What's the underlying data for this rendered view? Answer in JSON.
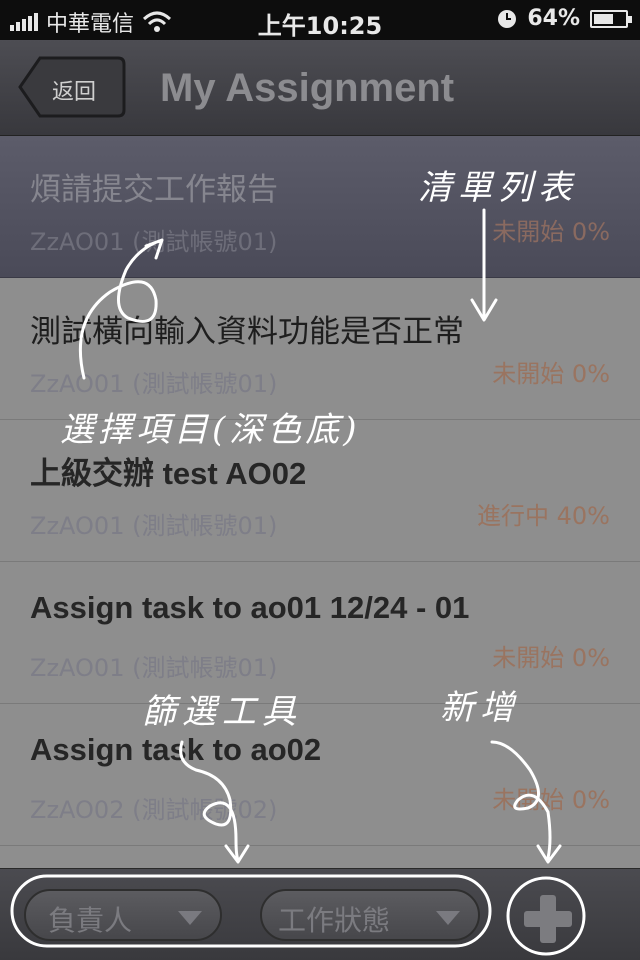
{
  "status_bar": {
    "carrier": "中華電信",
    "time": "上午10:25",
    "battery": "64%",
    "battery_level": 0.64
  },
  "nav": {
    "back_label": "返回",
    "title": "My Assignment"
  },
  "list": [
    {
      "title": "煩請提交工作報告",
      "owner": "ZzAO01 (測試帳號01)",
      "status": "未開始 0%",
      "selected": true
    },
    {
      "title": "測試橫向輸入資料功能是否正常",
      "owner": "ZzAO01 (測試帳號01)",
      "status": "未開始 0%",
      "selected": false
    },
    {
      "title": "上級交辦 test AO02",
      "owner": "ZzAO01 (測試帳號01)",
      "status": "進行中 40%",
      "selected": false
    },
    {
      "title": "Assign task to ao01 12/24 - 01",
      "owner": "ZzAO01 (測試帳號01)",
      "status": "未開始 0%",
      "selected": false
    },
    {
      "title": "Assign task to ao02",
      "owner": "ZzAO02 (測試帳號02)",
      "status": "未開始 0%",
      "selected": false
    }
  ],
  "toolbar": {
    "filter_owner": "負責人",
    "filter_status": "工作狀態"
  },
  "annotations": {
    "list_label": "清單列表",
    "selected_label": "選擇項目(深色底)",
    "filter_label": "篩選工具",
    "add_label": "新增"
  },
  "icons": {
    "back": "back-arrow-icon",
    "add": "plus-icon",
    "dropdown": "triangle-down-icon",
    "wifi": "wifi-icon",
    "clock": "clock-icon",
    "battery": "battery-icon"
  }
}
